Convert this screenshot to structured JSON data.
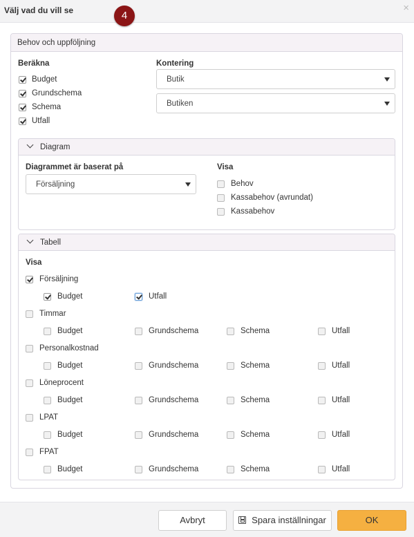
{
  "dialog": {
    "title": "Välj vad du vill se",
    "step_badge": "4",
    "close_icon": "close-icon"
  },
  "panel": {
    "title": "Behov och uppföljning",
    "berakna": {
      "label": "Beräkna",
      "options": [
        {
          "label": "Budget",
          "checked": true
        },
        {
          "label": "Grundschema",
          "checked": true
        },
        {
          "label": "Schema",
          "checked": true
        },
        {
          "label": "Utfall",
          "checked": true
        }
      ]
    },
    "kontering": {
      "label": "Kontering",
      "select1": "Butik",
      "select2": "Butiken"
    },
    "diagram": {
      "title": "Diagram",
      "based_on_label": "Diagrammet är baserat på",
      "based_on_value": "Försäljning",
      "visa_label": "Visa",
      "visa_options": [
        {
          "label": "Behov",
          "checked": false
        },
        {
          "label": "Kassabehov (avrundat)",
          "checked": false
        },
        {
          "label": "Kassabehov",
          "checked": false
        }
      ]
    },
    "tabell": {
      "title": "Tabell",
      "visa_label": "Visa",
      "groups": [
        {
          "label": "Försäljning",
          "checked": true,
          "sub": [
            {
              "label": "Budget",
              "checked": true
            },
            {
              "label": "Utfall",
              "checked": true
            }
          ]
        },
        {
          "label": "Timmar",
          "checked": false,
          "sub": [
            {
              "label": "Budget",
              "checked": false
            },
            {
              "label": "Grundschema",
              "checked": false
            },
            {
              "label": "Schema",
              "checked": false
            },
            {
              "label": "Utfall",
              "checked": false
            }
          ]
        },
        {
          "label": "Personalkostnad",
          "checked": false,
          "sub": [
            {
              "label": "Budget",
              "checked": false
            },
            {
              "label": "Grundschema",
              "checked": false
            },
            {
              "label": "Schema",
              "checked": false
            },
            {
              "label": "Utfall",
              "checked": false
            }
          ]
        },
        {
          "label": "Löneprocent",
          "checked": false,
          "sub": [
            {
              "label": "Budget",
              "checked": false
            },
            {
              "label": "Grundschema",
              "checked": false
            },
            {
              "label": "Schema",
              "checked": false
            },
            {
              "label": "Utfall",
              "checked": false
            }
          ]
        },
        {
          "label": "LPAT",
          "checked": false,
          "sub": [
            {
              "label": "Budget",
              "checked": false
            },
            {
              "label": "Grundschema",
              "checked": false
            },
            {
              "label": "Schema",
              "checked": false
            },
            {
              "label": "Utfall",
              "checked": false
            }
          ]
        },
        {
          "label": "FPAT",
          "checked": false,
          "sub": [
            {
              "label": "Budget",
              "checked": false
            },
            {
              "label": "Grundschema",
              "checked": false
            },
            {
              "label": "Schema",
              "checked": false
            },
            {
              "label": "Utfall",
              "checked": false
            }
          ]
        }
      ]
    }
  },
  "footer": {
    "cancel_label": "Avbryt",
    "save_label": "Spara inställningar",
    "save_icon": "floppy-disk-icon",
    "ok_label": "OK"
  },
  "colors": {
    "badge": "#8b1516",
    "primary_button": "#f5b041",
    "panel_header": "#f6f2f6"
  }
}
